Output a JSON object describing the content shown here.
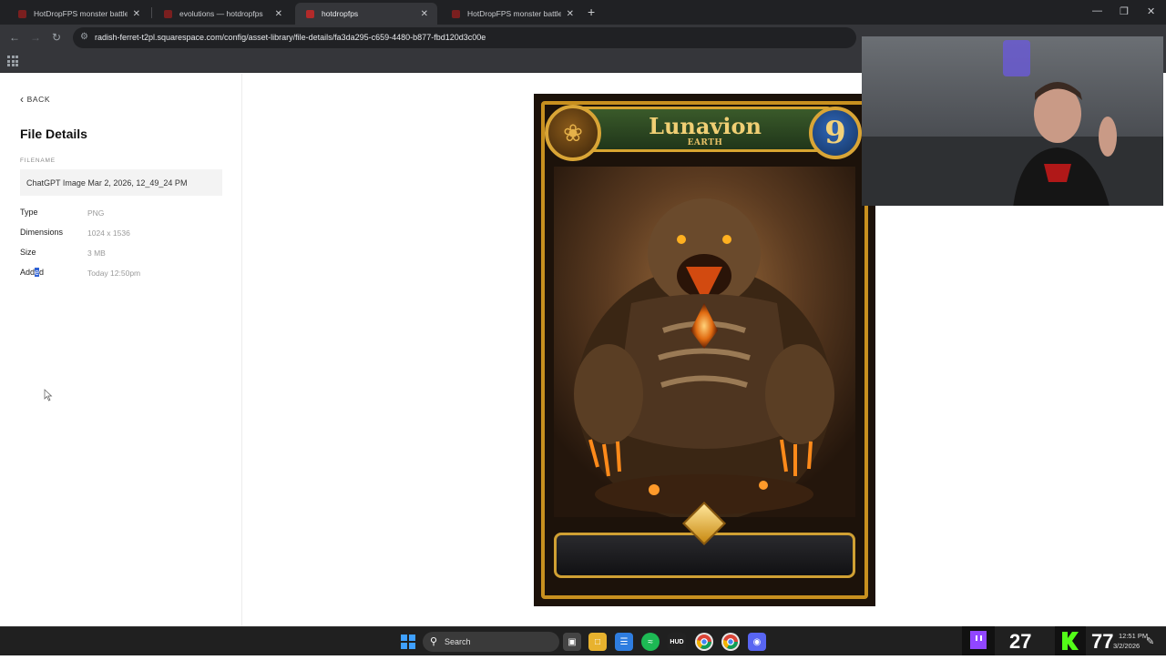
{
  "browser": {
    "tabs": [
      {
        "title": "HotDropFPS monster battle sty",
        "active": false
      },
      {
        "title": "evolutions — hotdropfps",
        "active": false
      },
      {
        "title": "hotdropfps",
        "active": true
      },
      {
        "title": "HotDropFPS monster battle sty",
        "active": false
      }
    ],
    "new_tab": "+",
    "close_glyph": "✕",
    "url": "radish-ferret-t2pl.squarespace.com/config/asset-library/file-details/fa3da295-c659-4480-b877-fbd120d3c00e",
    "window_controls": {
      "minimize": "—",
      "maximize": "❐",
      "close": "✕"
    }
  },
  "sidebar": {
    "back_label": "BACK",
    "title": "File Details",
    "filename_label": "FILENAME",
    "filename_value": "ChatGPT Image Mar 2, 2026, 12_49_24 PM",
    "meta": [
      {
        "key": "Type",
        "value": "PNG"
      },
      {
        "key": "Dimensions",
        "value": "1024 x 1536"
      },
      {
        "key": "Size",
        "value": "3 MB"
      },
      {
        "key_before": "Add",
        "key_selected": "e",
        "key_after": "d",
        "value": "Today 12:50pm"
      }
    ]
  },
  "card": {
    "name": "Lunavion",
    "element": "EARTH",
    "level": "9"
  },
  "taskbar": {
    "search_placeholder": "Search",
    "stat_left": "27",
    "stat_right": "77",
    "clock_time": "12:51 PM",
    "clock_date": "3/2/2026"
  },
  "colors": {
    "selection": "#2f62d6",
    "card_gold": "#d9a536",
    "chrome_dark": "#202124"
  }
}
